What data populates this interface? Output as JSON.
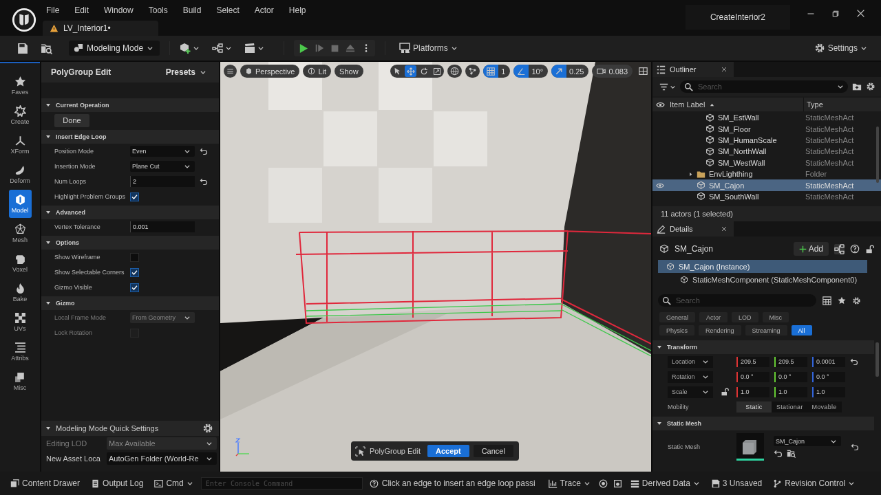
{
  "menu": [
    "File",
    "Edit",
    "Window",
    "Tools",
    "Build",
    "Select",
    "Actor",
    "Help"
  ],
  "document_tab": {
    "label": "LV_Interior1•"
  },
  "project": "CreateInterior2",
  "toolbar": {
    "mode": "Modeling Mode",
    "platforms": "Platforms",
    "settings": "Settings"
  },
  "mode_palette": [
    {
      "label": "Faves",
      "selected": false
    },
    {
      "label": "Create",
      "selected": false
    },
    {
      "label": "XForm",
      "selected": false
    },
    {
      "label": "Deform",
      "selected": false
    },
    {
      "label": "Model",
      "selected": true
    },
    {
      "label": "Mesh",
      "selected": false
    },
    {
      "label": "Voxel",
      "selected": false
    },
    {
      "label": "Bake",
      "selected": false
    },
    {
      "label": "UVs",
      "selected": false
    },
    {
      "label": "Attribs",
      "selected": false
    },
    {
      "label": "Misc",
      "selected": false
    }
  ],
  "tool_panel": {
    "title": "PolyGroup Edit",
    "presets": "Presets",
    "sections": [
      {
        "title": "Current Operation",
        "expanded": true,
        "rows": [
          {
            "kind": "button",
            "label": "Done",
            "disabled": false
          }
        ]
      },
      {
        "title": "Insert Edge Loop",
        "expanded": true,
        "rows": [
          {
            "kind": "dropdown",
            "label": "Position Mode",
            "value": "Even",
            "resettable": true,
            "disabled": false
          },
          {
            "kind": "dropdown",
            "label": "Insertion Mode",
            "value": "Plane Cut",
            "resettable": false,
            "disabled": false
          },
          {
            "kind": "number",
            "label": "Num Loops",
            "value": "2",
            "resettable": true,
            "disabled": false
          },
          {
            "kind": "checkbox",
            "label": "Highlight Problem Groups",
            "checked": true,
            "disabled": false
          }
        ]
      },
      {
        "title": "Advanced",
        "expanded": true,
        "rows": [
          {
            "kind": "number",
            "label": "Vertex Tolerance",
            "value": "0.001",
            "resettable": false,
            "disabled": false
          }
        ]
      },
      {
        "title": "Options",
        "expanded": true,
        "rows": [
          {
            "kind": "checkbox",
            "label": "Show Wireframe",
            "checked": false,
            "disabled": false
          },
          {
            "kind": "checkbox",
            "label": "Show Selectable Corners",
            "checked": true,
            "disabled": false
          },
          {
            "kind": "checkbox",
            "label": "Gizmo Visible",
            "checked": true,
            "disabled": false
          }
        ]
      },
      {
        "title": "Gizmo",
        "expanded": true,
        "rows": [
          {
            "kind": "dropdown",
            "label": "Local Frame Mode",
            "value": "From Geometry",
            "resettable": false,
            "disabled": true
          },
          {
            "kind": "checkbox",
            "label": "Lock Rotation",
            "checked": false,
            "disabled": true
          }
        ]
      }
    ]
  },
  "quick_settings": {
    "title": "Modeling Mode Quick Settings",
    "expanded": true,
    "rows": [
      {
        "label": "Editing LOD",
        "value": "Max Available",
        "disabled": true
      },
      {
        "label": "New Asset Loca",
        "value": "AutoGen Folder (World-Re",
        "disabled": false
      }
    ]
  },
  "viewport": {
    "kind": "picture",
    "view": "Perspective",
    "lighting": "Lit",
    "show": "Show",
    "transform_tools": [
      {
        "selected": false
      },
      {
        "selected": true
      },
      {
        "selected": false
      },
      {
        "selected": false
      }
    ],
    "snaps": [
      {
        "value": "1",
        "on": true
      },
      {
        "value": "10°",
        "on": true
      },
      {
        "value": "0.25",
        "on": true
      }
    ],
    "camera_speed": "0.083",
    "tool_bar": {
      "label": "PolyGroup Edit",
      "accept": "Accept",
      "cancel": "Cancel"
    }
  },
  "outliner": {
    "title": "Outliner",
    "search_placeholder": "Search",
    "columns": [
      "Item Label",
      "Type"
    ],
    "rows": [
      {
        "children": [
          {
            "label": "SM_EstWall",
            "type": "StaticMeshAct",
            "kind": "mesh",
            "selected": false
          },
          {
            "label": "SM_Floor",
            "type": "StaticMeshAct",
            "kind": "mesh",
            "selected": false
          },
          {
            "label": "SM_HumanScale",
            "type": "StaticMeshAct",
            "kind": "mesh",
            "selected": false
          },
          {
            "label": "SM_NorthWall",
            "type": "StaticMeshAct",
            "kind": "mesh",
            "selected": false
          },
          {
            "label": "SM_WestWall",
            "type": "StaticMeshAct",
            "kind": "mesh",
            "selected": false
          }
        ]
      },
      {
        "label": "EnvLighthing",
        "type": "Folder",
        "kind": "folder",
        "expanded": false,
        "selected": false
      },
      {
        "label": "SM_Cajon",
        "type": "StaticMeshAct",
        "kind": "mesh",
        "selected": true
      },
      {
        "label": "SM_SouthWall",
        "type": "StaticMeshAct",
        "kind": "mesh",
        "selected": false
      }
    ],
    "footer": "11 actors (1 selected)"
  },
  "details": {
    "title": "Details",
    "actor": "SM_Cajon",
    "add": "Add",
    "components": [
      {
        "label": "SM_Cajon (Instance)",
        "selected": true,
        "children": [
          {
            "label": "StaticMeshComponent (StaticMeshComponent0)",
            "selected": false
          }
        ]
      }
    ],
    "search_placeholder": "Search",
    "filters": [
      {
        "label": "General",
        "selected": false
      },
      {
        "label": "Actor",
        "selected": false
      },
      {
        "label": "LOD",
        "selected": false
      },
      {
        "label": "Misc",
        "selected": false
      },
      {
        "label": "Physics",
        "selected": false
      },
      {
        "label": "Rendering",
        "selected": false
      },
      {
        "label": "Streaming",
        "selected": false
      },
      {
        "label": "All",
        "selected": true
      }
    ],
    "transform": {
      "title": "Transform",
      "expanded": true,
      "rows": [
        {
          "label": "Location",
          "values": [
            "209.5",
            "209.5",
            "0.0001"
          ]
        },
        {
          "label": "Rotation",
          "values": [
            "0.0 °",
            "0.0 °",
            "0.0 °"
          ]
        },
        {
          "label": "Scale",
          "values": [
            "1.0",
            "1.0",
            "1.0"
          ],
          "locked": false
        }
      ],
      "mobility_label": "Mobility",
      "mobility": [
        {
          "label": "Static",
          "selected": true
        },
        {
          "label": "Stationar",
          "selected": false
        },
        {
          "label": "Movable",
          "selected": false
        }
      ]
    },
    "static_mesh": {
      "title": "Static Mesh",
      "expanded": true,
      "label": "Static Mesh",
      "value": "SM_Cajon"
    }
  },
  "status_bar": {
    "content_drawer": "Content Drawer",
    "output_log": "Output Log",
    "cmd": "Cmd",
    "console_placeholder": "Enter Console Command",
    "hint": "Click an edge to insert an edge loop passi",
    "trace": "Trace",
    "derived_data": "Derived Data",
    "unsaved": "3 Unsaved",
    "revision_control": "Revision Control"
  }
}
